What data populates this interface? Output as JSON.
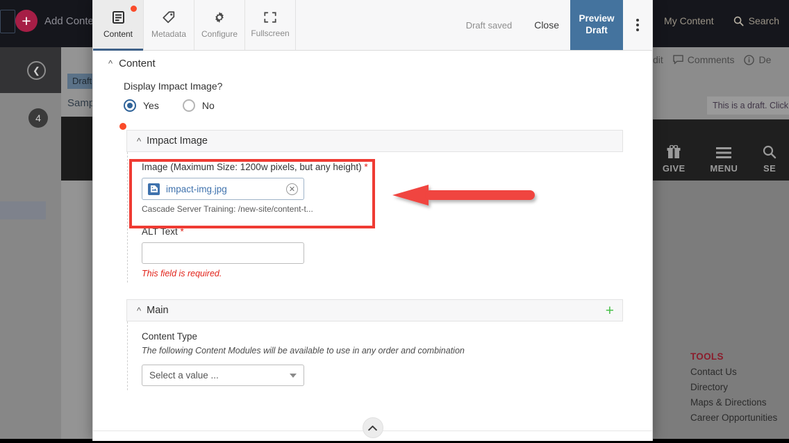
{
  "background": {
    "topbar": {
      "add_content_label": "Add Content",
      "add_content_icon": "plus-circle-icon",
      "my_content_label": "My Content",
      "search_label": "Search",
      "search_icon": "search-icon"
    },
    "sidebar": {
      "back_icon": "chevron-left-circle-icon",
      "badge_count": "4",
      "draft_badge": "Draft",
      "page_title_partial": "Samp"
    },
    "subbar": {
      "edit_label": "dit",
      "comments_label": "Comments",
      "comments_icon": "comment-icon",
      "details_label": "De",
      "details_icon": "info-icon"
    },
    "draft_notice": "This is a draft. Click Su",
    "site_nav": [
      {
        "label": "GIVE",
        "icon": "gift-icon"
      },
      {
        "label": "MENU",
        "icon": "hamburger-icon"
      },
      {
        "label": "SE",
        "icon": "search-icon"
      }
    ],
    "footer": {
      "tools_title": "TOOLS",
      "tools_color": "#8b1d2c",
      "links": [
        "Contact Us",
        "Directory",
        "Maps & Directions",
        "Career Opportunities"
      ]
    }
  },
  "modal": {
    "tabs": [
      {
        "label": "Content",
        "icon": "document-icon",
        "active": true,
        "has_dot": true
      },
      {
        "label": "Metadata",
        "icon": "tag-icon",
        "active": false,
        "has_dot": false
      },
      {
        "label": "Configure",
        "icon": "gear-icon",
        "active": false,
        "has_dot": false
      },
      {
        "label": "Fullscreen",
        "icon": "expand-icon",
        "active": false,
        "has_dot": false
      }
    ],
    "status_text": "Draft saved",
    "close_label": "Close",
    "preview_draft_label": "Preview Draft",
    "kebab_icon": "more-vertical-icon",
    "content_section": {
      "title": "Content",
      "collapse_icon": "chevron-up-icon",
      "display_impact_image": {
        "label": "Display Impact Image?",
        "options": [
          {
            "label": "Yes",
            "selected": true
          },
          {
            "label": "No",
            "selected": false
          }
        ]
      }
    },
    "impact_image_panel": {
      "title": "Impact Image",
      "collapse_icon": "chevron-up-icon",
      "image_field": {
        "label": "Image (Maximum Size: 1200w pixels, but any height)",
        "required_marker": "*",
        "file_name": "impact-img.jpg",
        "file_icon": "image-file-icon",
        "clear_icon": "clear-circle-icon",
        "file_path": "Cascade Server Training: /new-site/content-t..."
      },
      "alt_field": {
        "label": "ALT Text",
        "required_marker": "*",
        "value": "",
        "placeholder": "",
        "error": "This field is required."
      }
    },
    "main_panel": {
      "title": "Main",
      "collapse_icon": "chevron-up-icon",
      "add_icon": "plus-icon",
      "add_icon_color": "#49c04a",
      "content_type": {
        "label": "Content Type",
        "hint": "The following Content Modules will be available to use in any order and combination",
        "selected": "Select a value ...",
        "caret_icon": "chevron-down-icon"
      }
    },
    "collapse_footer_icon": "chevron-up-icon"
  },
  "annotations": {
    "highlight_color": "#ef3b33",
    "arrow_color": "#f0443f",
    "arrow_direction": "left"
  }
}
